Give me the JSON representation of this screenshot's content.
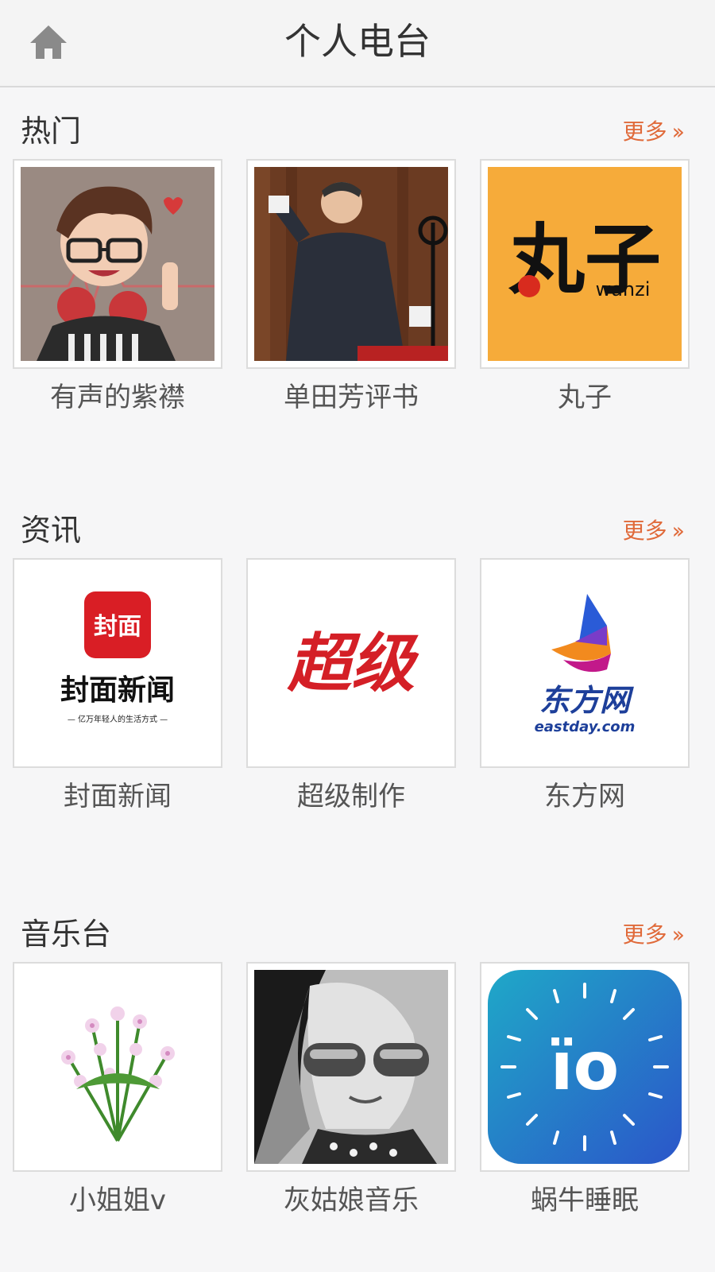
{
  "header": {
    "title": "个人电台",
    "home_icon": "home-icon"
  },
  "sections": [
    {
      "title": "热门",
      "more_label": "更多",
      "items": [
        {
          "label": "有声的紫襟"
        },
        {
          "label": "单田芳评书"
        },
        {
          "label": "丸子",
          "art_text": "丸子",
          "art_subtext": "wanzi"
        }
      ]
    },
    {
      "title": "资讯",
      "more_label": "更多",
      "items": [
        {
          "label": "封面新闻",
          "art_badge": "封面",
          "art_text": "封面新闻",
          "art_subtext": "— 亿万年轻人的生活方式 —"
        },
        {
          "label": "超级制作",
          "art_text": "超级"
        },
        {
          "label": "东方网",
          "art_text": "东方网",
          "art_subtext": "eastday.com"
        }
      ]
    },
    {
      "title": "音乐台",
      "more_label": "更多",
      "items": [
        {
          "label": "小姐姐v"
        },
        {
          "label": "灰姑娘音乐"
        },
        {
          "label": "蜗牛睡眠",
          "art_text": "ïo"
        }
      ]
    }
  ],
  "colors": {
    "accent": "#e06a3a",
    "text": "#333333",
    "label": "#555555",
    "background": "#f6f6f7"
  }
}
